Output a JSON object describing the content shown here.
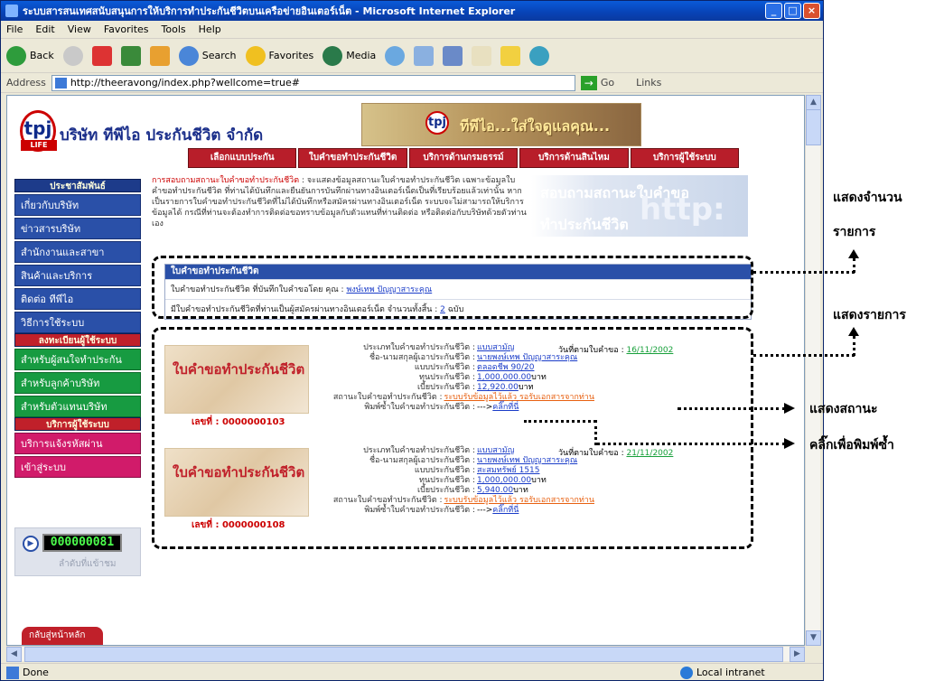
{
  "window": {
    "title": "ระบบสารสนเทศสนับสนุนการให้บริการทำประกันชีวิตบนเครือข่ายอินเตอร์เน็ต - Microsoft Internet Explorer",
    "caption_buttons": [
      "_",
      "□",
      "×"
    ]
  },
  "menu": [
    "File",
    "Edit",
    "View",
    "Favorites",
    "Tools",
    "Help"
  ],
  "toolbar": {
    "back": "Back",
    "search": "Search",
    "favorites": "Favorites",
    "media": "Media"
  },
  "address": {
    "label": "Address",
    "url": "http://theeravong/index.php?wellcome=true#",
    "go": "Go",
    "links": "Links"
  },
  "status": {
    "left": "Done",
    "zone": "Local intranet"
  },
  "header": {
    "logo": "tpj",
    "logo_sub": "LIFE",
    "company": "บริษัท ทีพีไอ ประกันชีวิต จำกัด",
    "slogan": "ทีพีไอ...ใส่ใจดูแลคุณ...",
    "nav": [
      "เลือกแบบประกัน",
      "ใบคำขอทำประกันชีวิต",
      "บริการด้านกรมธรรม์",
      "บริการด้านสินไหม",
      "บริการผู้ใช้ระบบ"
    ]
  },
  "sidebar": {
    "sections": [
      {
        "title": "ประชาสัมพันธ์",
        "style": "blue",
        "items": [
          "เกี่ยวกับบริษัท",
          "ข่าวสารบริษัท",
          "สำนักงานและสาขา",
          "สินค้าและบริการ",
          "ติดต่อ ทีพีไอ",
          "วิธีการใช้ระบบ"
        ]
      },
      {
        "title": "ลงทะเบียนผู้ใช้ระบบ",
        "style": "red",
        "items": [
          "สำหรับผู้สนใจทำประกัน",
          "สำหรับลูกค้าบริษัท",
          "สำหรับตัวแทนบริษัท"
        ]
      },
      {
        "title": "บริการผู้ใช้ระบบ",
        "style": "red",
        "items": [
          "บริการแจ้งรหัสผ่าน",
          "เข้าสู่ระบบ"
        ]
      }
    ],
    "counter": "000000081",
    "counter_caption": "ลำดับที่แข้าชม",
    "back_home": "กลับสู่หน้าหลัก"
  },
  "intro": {
    "lead": "การสอบถามสถานะใบคำขอทำประกันชีวิต",
    "text": " : จะแสดงข้อมูลสถานะใบคำขอทำประกันชีวิต เฉพาะข้อมูลใบคำขอทำประกันชีวิต ที่ท่านได้บันทึกและยืนยันการบันทึกผ่านทางอินเตอร์เน็ตเป็นที่เรียบร้อยแล้วเท่านั้น หากเป็นรายการใบคำขอทำประกันชีวิตที่ไม่ได้บันทึกหรือสมัครผ่านทางอินเตอร์เน็ต ระบบจะไม่สามารถให้บริการข้อมูลได้ กรณีที่ท่านจะต้องทำการติดต่อขอทราบข้อมูลกับตัวแทนที่ท่านติดต่อ หรือติดต่อกับบริษัทด้วยตัวท่านเอง",
    "banner": "สอบถามสถานะใบคำขอ",
    "banner2": "ทำประกันชีวิต",
    "banner_big": "http:"
  },
  "list": {
    "title": "ใบคำขอทำประกันชีวิต",
    "row1_label": "ใบคำขอทำประกันชีวิต ที่บันทึกใบคำขอโดย คุณ : ",
    "row1_name": "พงษ์เทพ ปัญญาสาระคุณ",
    "row2_label": "มีใบคำขอทำประกันชีวิตที่ท่านเป็นผู้สมัครผ่านทางอินเตอร์เน็ต จำนวนทั้งสิ้น : ",
    "row2_count": "2",
    "row2_unit": " ฉบับ"
  },
  "records": [
    {
      "image_text": "ใบคำขอทำประกันชีวิต",
      "no_label": "เลขที่ : ",
      "no": "0000000103",
      "date_label": "วันที่ตามใบคำขอ : ",
      "date": "16/11/2002",
      "fields": [
        {
          "label": "ประเภทใบคำขอทำประกันชีวิต : ",
          "value": "แบบสามัญ",
          "kind": "link"
        },
        {
          "label": "ชื่อ-นามสกุลผู้เอาประกันชีวิต : ",
          "value": "นายพงษ์เทพ ปัญญาสาระคุณ",
          "kind": "link"
        },
        {
          "label": "แบบประกันชีวิต : ",
          "value": "ตลอดชีพ 90/20",
          "kind": "link"
        },
        {
          "label": "ทุนประกันชีวิต : ",
          "value": "1,000,000.00",
          "kind": "link",
          "suffix": " บาท"
        },
        {
          "label": "เบี้ยประกันชีวิต : ",
          "value": "12,920.00",
          "kind": "link",
          "suffix": " บาท"
        },
        {
          "label": "สถานะใบคำขอทำประกันชีวิต : ",
          "value": "ระบบรับข้อมูลไว้แล้ว รอรับเอกสารจากท่าน",
          "kind": "orange"
        },
        {
          "label": "พิมพ์ซ้ำใบคำขอทำประกันชีวิต : ",
          "value": "คลิ๊กที่นี่",
          "kind": "link",
          "prefix": "---> "
        }
      ]
    },
    {
      "image_text": "ใบคำขอทำประกันชีวิต",
      "no_label": "เลขที่ : ",
      "no": "0000000108",
      "date_label": "วันที่ตามใบคำขอ : ",
      "date": "21/11/2002",
      "fields": [
        {
          "label": "ประเภทใบคำขอทำประกันชีวิต : ",
          "value": "แบบสามัญ",
          "kind": "link"
        },
        {
          "label": "ชื่อ-นามสกุลผู้เอาประกันชีวิต : ",
          "value": "นายพงษ์เทพ ปัญญาสาระคุณ",
          "kind": "link"
        },
        {
          "label": "แบบประกันชีวิต : ",
          "value": "สะสมทรัพย์ 1515",
          "kind": "link"
        },
        {
          "label": "ทุนประกันชีวิต : ",
          "value": "1,000,000.00",
          "kind": "link",
          "suffix": " บาท"
        },
        {
          "label": "เบี้ยประกันชีวิต : ",
          "value": "5,940.00",
          "kind": "link",
          "suffix": " บาท"
        },
        {
          "label": "สถานะใบคำขอทำประกันชีวิต : ",
          "value": "ระบบรับข้อมูลไว้แล้ว รอรับเอกสารจากท่าน",
          "kind": "orange"
        },
        {
          "label": "พิมพ์ซ้ำใบคำขอทำประกันชีวิต : ",
          "value": "คลิ๊กที่นี่",
          "kind": "link",
          "prefix": "---> "
        }
      ]
    }
  ],
  "annotations": {
    "count1": "แสดงจำนวน",
    "count2": "รายการ",
    "list": "แสดงรายการ",
    "status": "แสดงสถานะ",
    "reprint": "คลิ๊กเพื่อพิมพ์ซ้ำ"
  }
}
